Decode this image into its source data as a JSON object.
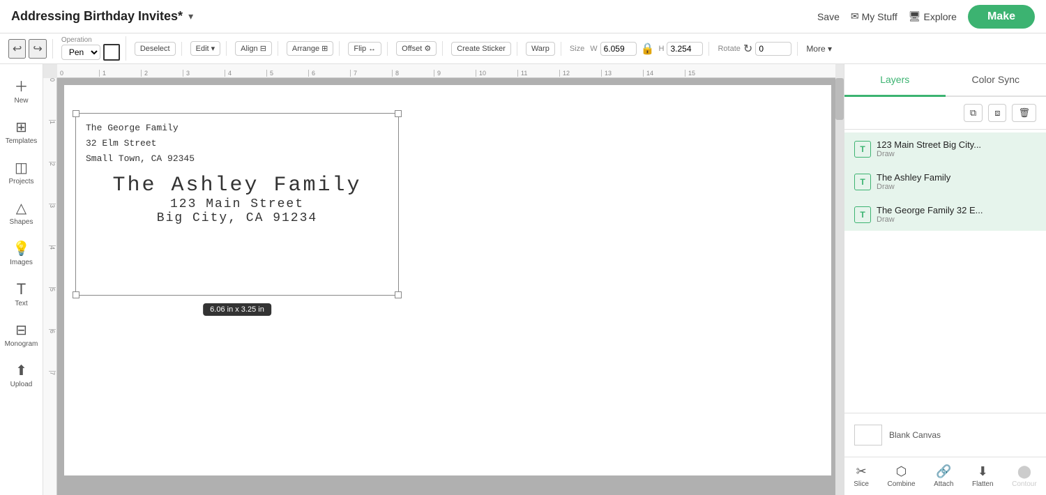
{
  "header": {
    "title": "Addressing Birthday Invites*",
    "dropdown_icon": "▾",
    "save_label": "Save",
    "mystuff_label": "My Stuff",
    "explore_label": "Explore",
    "make_label": "Make"
  },
  "toolbar": {
    "operation_label": "Operation",
    "pen_label": "Pen",
    "deselect_label": "Deselect",
    "edit_label": "Edit",
    "align_label": "Align",
    "arrange_label": "Arrange",
    "flip_label": "Flip",
    "offset_label": "Offset",
    "create_sticker_label": "Create Sticker",
    "warp_label": "Warp",
    "size_label": "Size",
    "w_label": "W",
    "w_value": "6.059",
    "h_label": "H",
    "h_value": "3.254",
    "rotate_label": "Rotate",
    "rotate_value": "0",
    "more_label": "More ▾"
  },
  "sidebar": {
    "items": [
      {
        "id": "new",
        "icon": "＋",
        "label": "New"
      },
      {
        "id": "templates",
        "icon": "⊞",
        "label": "Templates"
      },
      {
        "id": "projects",
        "icon": "◫",
        "label": "Projects"
      },
      {
        "id": "shapes",
        "icon": "△",
        "label": "Shapes"
      },
      {
        "id": "images",
        "icon": "💡",
        "label": "Images"
      },
      {
        "id": "text",
        "icon": "T",
        "label": "Text"
      },
      {
        "id": "monogram",
        "icon": "⊟",
        "label": "Monogram"
      },
      {
        "id": "upload",
        "icon": "↑",
        "label": "Upload"
      }
    ]
  },
  "canvas": {
    "ruler_marks": [
      "0",
      "1",
      "2",
      "3",
      "4",
      "5",
      "6",
      "7",
      "8",
      "9",
      "10",
      "11",
      "12",
      "13",
      "14",
      "15"
    ],
    "design": {
      "address_top_line1": "The George Family",
      "address_top_line2": "32 Elm Street",
      "address_top_line3": "Small Town, CA 92345",
      "address_main_line1": "The Ashley Family",
      "address_main_line2": "123 Main Street",
      "address_main_line3": "Big City, CA 91234",
      "size_tooltip": "6.06  in x 3.25  in"
    }
  },
  "right_panel": {
    "tabs": [
      {
        "id": "layers",
        "label": "Layers",
        "active": true
      },
      {
        "id": "colorsync",
        "label": "Color Sync",
        "active": false
      }
    ],
    "action_icons": [
      "⧉",
      "⧈",
      "🗑"
    ],
    "layers": [
      {
        "id": "layer1",
        "name": "123 Main Street Big City...",
        "sub": "Draw",
        "selected": true
      },
      {
        "id": "layer2",
        "name": "The Ashley Family",
        "sub": "Draw",
        "selected": true
      },
      {
        "id": "layer3",
        "name": "The George Family 32 E...",
        "sub": "Draw",
        "selected": true
      }
    ],
    "blank_canvas_label": "Blank Canvas",
    "bottom_tools": [
      {
        "id": "slice",
        "icon": "✂",
        "label": "Slice",
        "disabled": false
      },
      {
        "id": "combine",
        "icon": "⬡",
        "label": "Combine",
        "disabled": false
      },
      {
        "id": "attach",
        "icon": "🔗",
        "label": "Attach",
        "disabled": false
      },
      {
        "id": "flatten",
        "icon": "⬇",
        "label": "Flatten",
        "disabled": false
      },
      {
        "id": "contour",
        "icon": "⬤",
        "label": "Contour",
        "disabled": true
      }
    ]
  }
}
